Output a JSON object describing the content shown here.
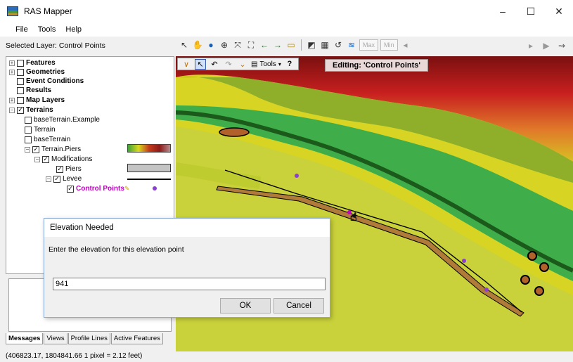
{
  "window": {
    "title": "RAS Mapper",
    "controls": [
      "–",
      "☐",
      "✕"
    ]
  },
  "menu": {
    "items": [
      "File",
      "Tools",
      "Help"
    ]
  },
  "selected_layer_label": "Selected Layer: Control Points",
  "toolbar": {
    "max_label": "Max",
    "min_label": "Min"
  },
  "edit_toolbar": {
    "tools_label": "Tools",
    "help_label": "?",
    "editing_label": "Editing: 'Control Points'"
  },
  "tree": {
    "features": "Features",
    "geometries": "Geometries",
    "event_conditions": "Event Conditions",
    "results": "Results",
    "map_layers": "Map Layers",
    "terrains": "Terrains",
    "base_terrain_example": "baseTerrain.Example",
    "terrain": "Terrain",
    "base_terrain": "baseTerrain",
    "terrain_piers": "Terrain.Piers",
    "modifications": "Modifications",
    "piers": "Piers",
    "levee": "Levee",
    "control_points": "Control Points"
  },
  "bottom_tabs": [
    "Messages",
    "Views",
    "Profile Lines",
    "Active Features"
  ],
  "status": "(406823.17, 1804841.66  1 pixel = 2.12 feet)",
  "dialog": {
    "title": "Elevation Needed",
    "prompt": "Enter the elevation for this elevation point",
    "value": "941",
    "ok_label": "OK",
    "cancel_label": "Cancel"
  },
  "colors": {
    "control_point": "#8a3fd1",
    "levee_fill": "#b07a38",
    "pier_fill": "#b0622a",
    "control_points_label": "#c000c0"
  }
}
